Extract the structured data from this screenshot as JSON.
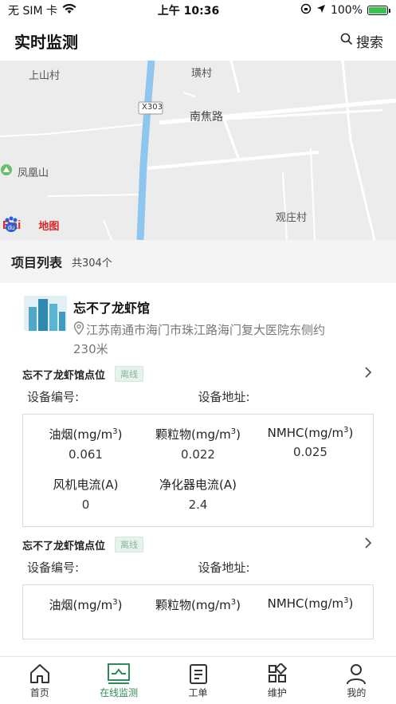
{
  "status_bar": {
    "carrier": "无 SIM 卡",
    "time": "上午 10:36",
    "battery": "100%"
  },
  "header": {
    "title": "实时监测",
    "search_label": "搜索"
  },
  "map": {
    "labels": {
      "shangshan": "上山村",
      "huang": "璜村",
      "road_code": "X303",
      "nanjiao": "南焦路",
      "fenghuang": "凤凰山",
      "guanzhuang": "观庄村"
    },
    "logo_text": "地图"
  },
  "list_header": {
    "title": "项目列表",
    "count": "共304个"
  },
  "project": {
    "name": "忘不了龙虾馆",
    "address": "江苏南通市海门市珠江路海门复大医院东侧约",
    "distance": "230米"
  },
  "points": [
    {
      "name": "忘不了龙虾馆点位",
      "status": "离线",
      "device_no_label": "设备编号:",
      "device_addr_label": "设备地址:",
      "metrics": [
        {
          "label": "油烟(mg/m",
          "value": "0.061"
        },
        {
          "label": "颗粒物(mg/m",
          "value": "0.022"
        },
        {
          "label": "NMHC(mg/m",
          "value": "0.025"
        }
      ],
      "metrics2": [
        {
          "label": "风机电流(A)",
          "value": "0"
        },
        {
          "label": "净化器电流(A)",
          "value": "2.4"
        }
      ]
    },
    {
      "name": "忘不了龙虾馆点位",
      "status": "离线",
      "device_no_label": "设备编号:",
      "device_addr_label": "设备地址:",
      "metrics": [
        {
          "label": "油烟(mg/m"
        },
        {
          "label": "颗粒物(mg/m"
        },
        {
          "label": "NMHC(mg/m"
        }
      ]
    }
  ],
  "tabs": [
    {
      "label": "首页",
      "icon": "home-icon"
    },
    {
      "label": "在线监测",
      "icon": "monitor-icon",
      "active": true
    },
    {
      "label": "工单",
      "icon": "workorder-icon"
    },
    {
      "label": "维护",
      "icon": "grid-icon"
    },
    {
      "label": "我的",
      "icon": "user-icon"
    }
  ],
  "colors": {
    "accent": "#2e8b57",
    "map_bg": "#ececec",
    "river": "#8ec6f0"
  }
}
